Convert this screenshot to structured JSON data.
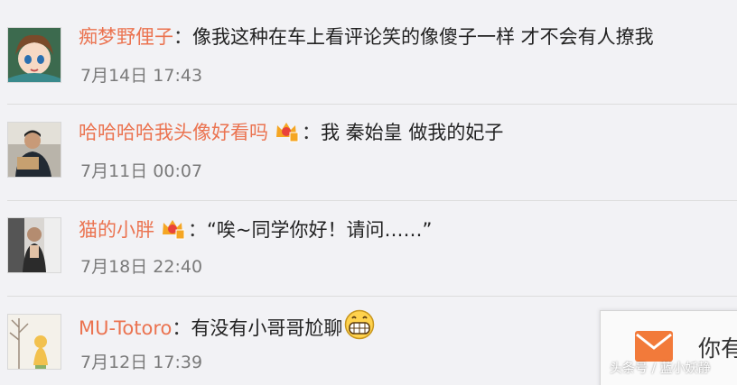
{
  "comments": [
    {
      "username": "痴梦野俚子",
      "separator": "：",
      "text": "像我这种在车上看评论笑的像傻子一样 才不会有人撩我",
      "time": "7月14日 17:43",
      "has_vip_badge": false,
      "has_emoji": false
    },
    {
      "username": "哈哈哈哈我头像好看吗",
      "separator": "：",
      "text": "我 秦始皇 做我的妃子",
      "time": "7月11日 00:07",
      "has_vip_badge": true,
      "has_emoji": false
    },
    {
      "username": "猫的小胖",
      "separator": "：",
      "text": "“唉~同学你好！请问……”",
      "time": "7月18日 22:40",
      "has_vip_badge": true,
      "has_emoji": false
    },
    {
      "username": "MU-Totoro",
      "separator": "：",
      "text": "有没有小哥哥尬聊",
      "time": "7月12日 17:39",
      "has_vip_badge": false,
      "has_emoji": true
    }
  ],
  "message_panel": {
    "text": "你有",
    "icon": "mail-icon"
  },
  "watermark": "头条号 / 蓝小妖静",
  "colors": {
    "username": "#eb7350",
    "text": "#222222",
    "time": "#7a7a7a",
    "background": "#f2f2f5",
    "mail_icon": "#f27a3a",
    "crown_badge": "#f5a623"
  }
}
